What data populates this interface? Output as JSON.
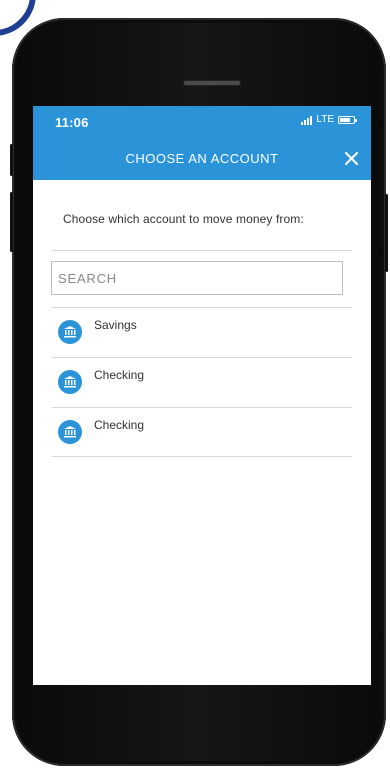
{
  "status": {
    "time": "11:06",
    "network": "LTE"
  },
  "header": {
    "title": "CHOOSE AN ACCOUNT",
    "close_icon": "close-icon"
  },
  "prompt": "Choose which account to move money from:",
  "search": {
    "placeholder": "SEARCH",
    "value": ""
  },
  "accounts": [
    {
      "label": "Savings",
      "icon": "bank-icon"
    },
    {
      "label": "Checking",
      "icon": "bank-icon"
    },
    {
      "label": "Checking",
      "icon": "bank-icon"
    }
  ],
  "colors": {
    "accent": "#2b94d9",
    "text": "#333333",
    "divider": "#d8d8d8"
  }
}
